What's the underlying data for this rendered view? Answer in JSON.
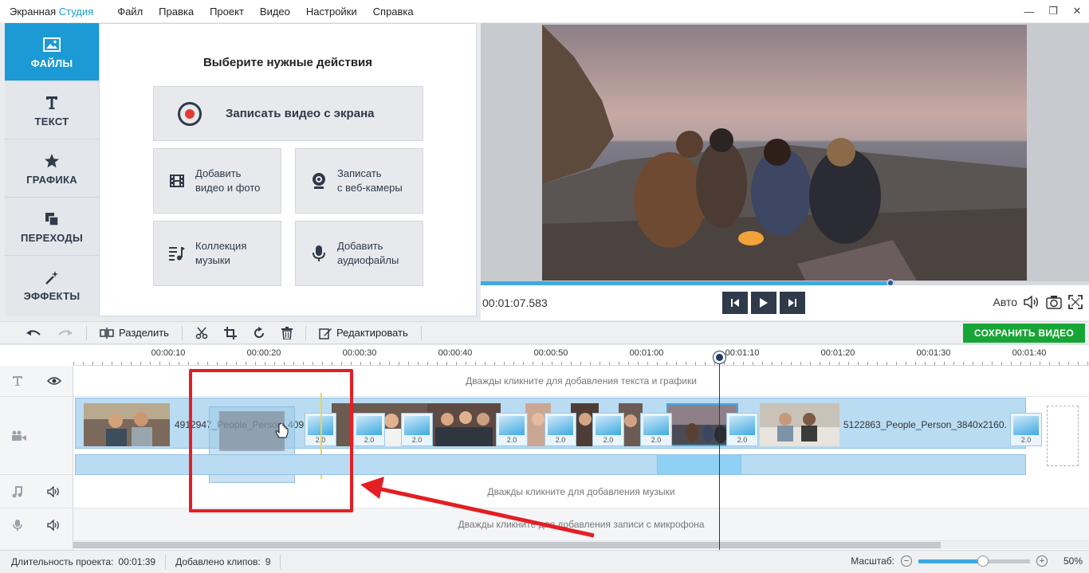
{
  "app": {
    "title_main": "Экранная ",
    "title_accent": "Студия"
  },
  "menu": [
    "Файл",
    "Правка",
    "Проект",
    "Видео",
    "Настройки",
    "Справка"
  ],
  "window_controls": [
    "—",
    "❐",
    "✕"
  ],
  "sidebar": {
    "items": [
      {
        "label": "ФАЙЛЫ",
        "icon": "image-icon",
        "active": true
      },
      {
        "label": "ТЕКСТ",
        "icon": "text-icon",
        "active": false
      },
      {
        "label": "ГРАФИКА",
        "icon": "star-icon",
        "active": false
      },
      {
        "label": "ПЕРЕХОДЫ",
        "icon": "transitions-icon",
        "active": false
      },
      {
        "label": "ЭФФЕКТЫ",
        "icon": "magic-wand-icon",
        "active": false
      }
    ]
  },
  "actions": {
    "title": "Выберите нужные действия",
    "record_screen": "Записать видео с экрана",
    "add_media": "Добавить\nвидео и фото",
    "webcam": "Записать\nс веб-камеры",
    "music": "Коллекция\nмузыки",
    "audio": "Добавить\nаудиофайлы"
  },
  "player": {
    "time": "00:01:07.583",
    "progress": 0.674,
    "auto_label": "Авто"
  },
  "toolbar": {
    "split": "Разделить",
    "edit": "Редактировать",
    "save": "СОХРАНИТЬ ВИДЕО"
  },
  "ruler": {
    "labels": [
      "00:00:10",
      "00:00:20",
      "00:00:30",
      "00:00:40",
      "00:00:50",
      "00:01:00",
      "00:01:10",
      "00:01:20",
      "00:01:30",
      "00:01:40"
    ]
  },
  "timeline": {
    "text_hint": "Дважды кликните для добавления текста и графики",
    "music_hint": "Дважды кликните для добавления музыки",
    "mic_hint": "Дважды кликните для добавления записи с микрофона",
    "clip_a_name": "4912947_People_Person_409",
    "clip_b_name": "5122863_People_Person_3840x2160.",
    "transition_value": "2.0"
  },
  "status": {
    "duration_label": "Длительность проекта:",
    "duration_value": "00:01:39",
    "clips_label": "Добавлено клипов:",
    "clips_value": "9",
    "zoom_label": "Масштаб:",
    "zoom_value": "50%",
    "zoom_level": 0.58
  },
  "colors": {
    "accent": "#1b9ad6",
    "save_green": "#17a535",
    "annotation_red": "#e31e24"
  }
}
